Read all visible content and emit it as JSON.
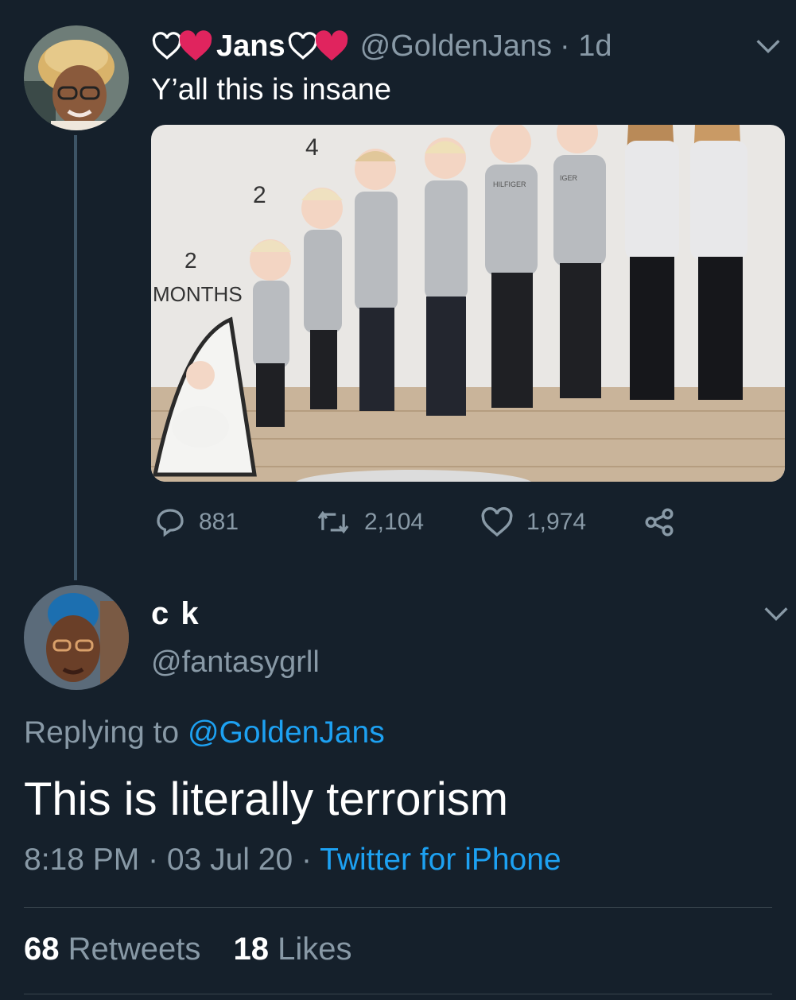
{
  "tweet": {
    "display_name": "Jans",
    "handle": "@GoldenJans",
    "time_ago": "· 1d",
    "text": "Y’all this is insane",
    "photo": {
      "labels": [
        "4",
        "2",
        "2",
        "MONTHS"
      ],
      "shirt_text_1": "HILFIGER",
      "shirt_text_2": "IGER"
    },
    "replies": "881",
    "retweets": "2,104",
    "likes": "1,974"
  },
  "reply": {
    "display_name": "c k",
    "handle": "@fantasygrll",
    "replying_prefix": "Replying to",
    "replying_to": "@GoldenJans",
    "text": "This is literally terrorism",
    "timestamp": "8:18 PM · 03 Jul 20 ·",
    "source": "Twitter for iPhone",
    "retweet_count": "68",
    "retweet_label": "Retweets",
    "like_count": "18",
    "like_label": "Likes"
  },
  "colors": {
    "background": "#15202b",
    "secondary_text": "#8899a6",
    "link": "#1da1f2",
    "heart_red": "#e0245e"
  }
}
